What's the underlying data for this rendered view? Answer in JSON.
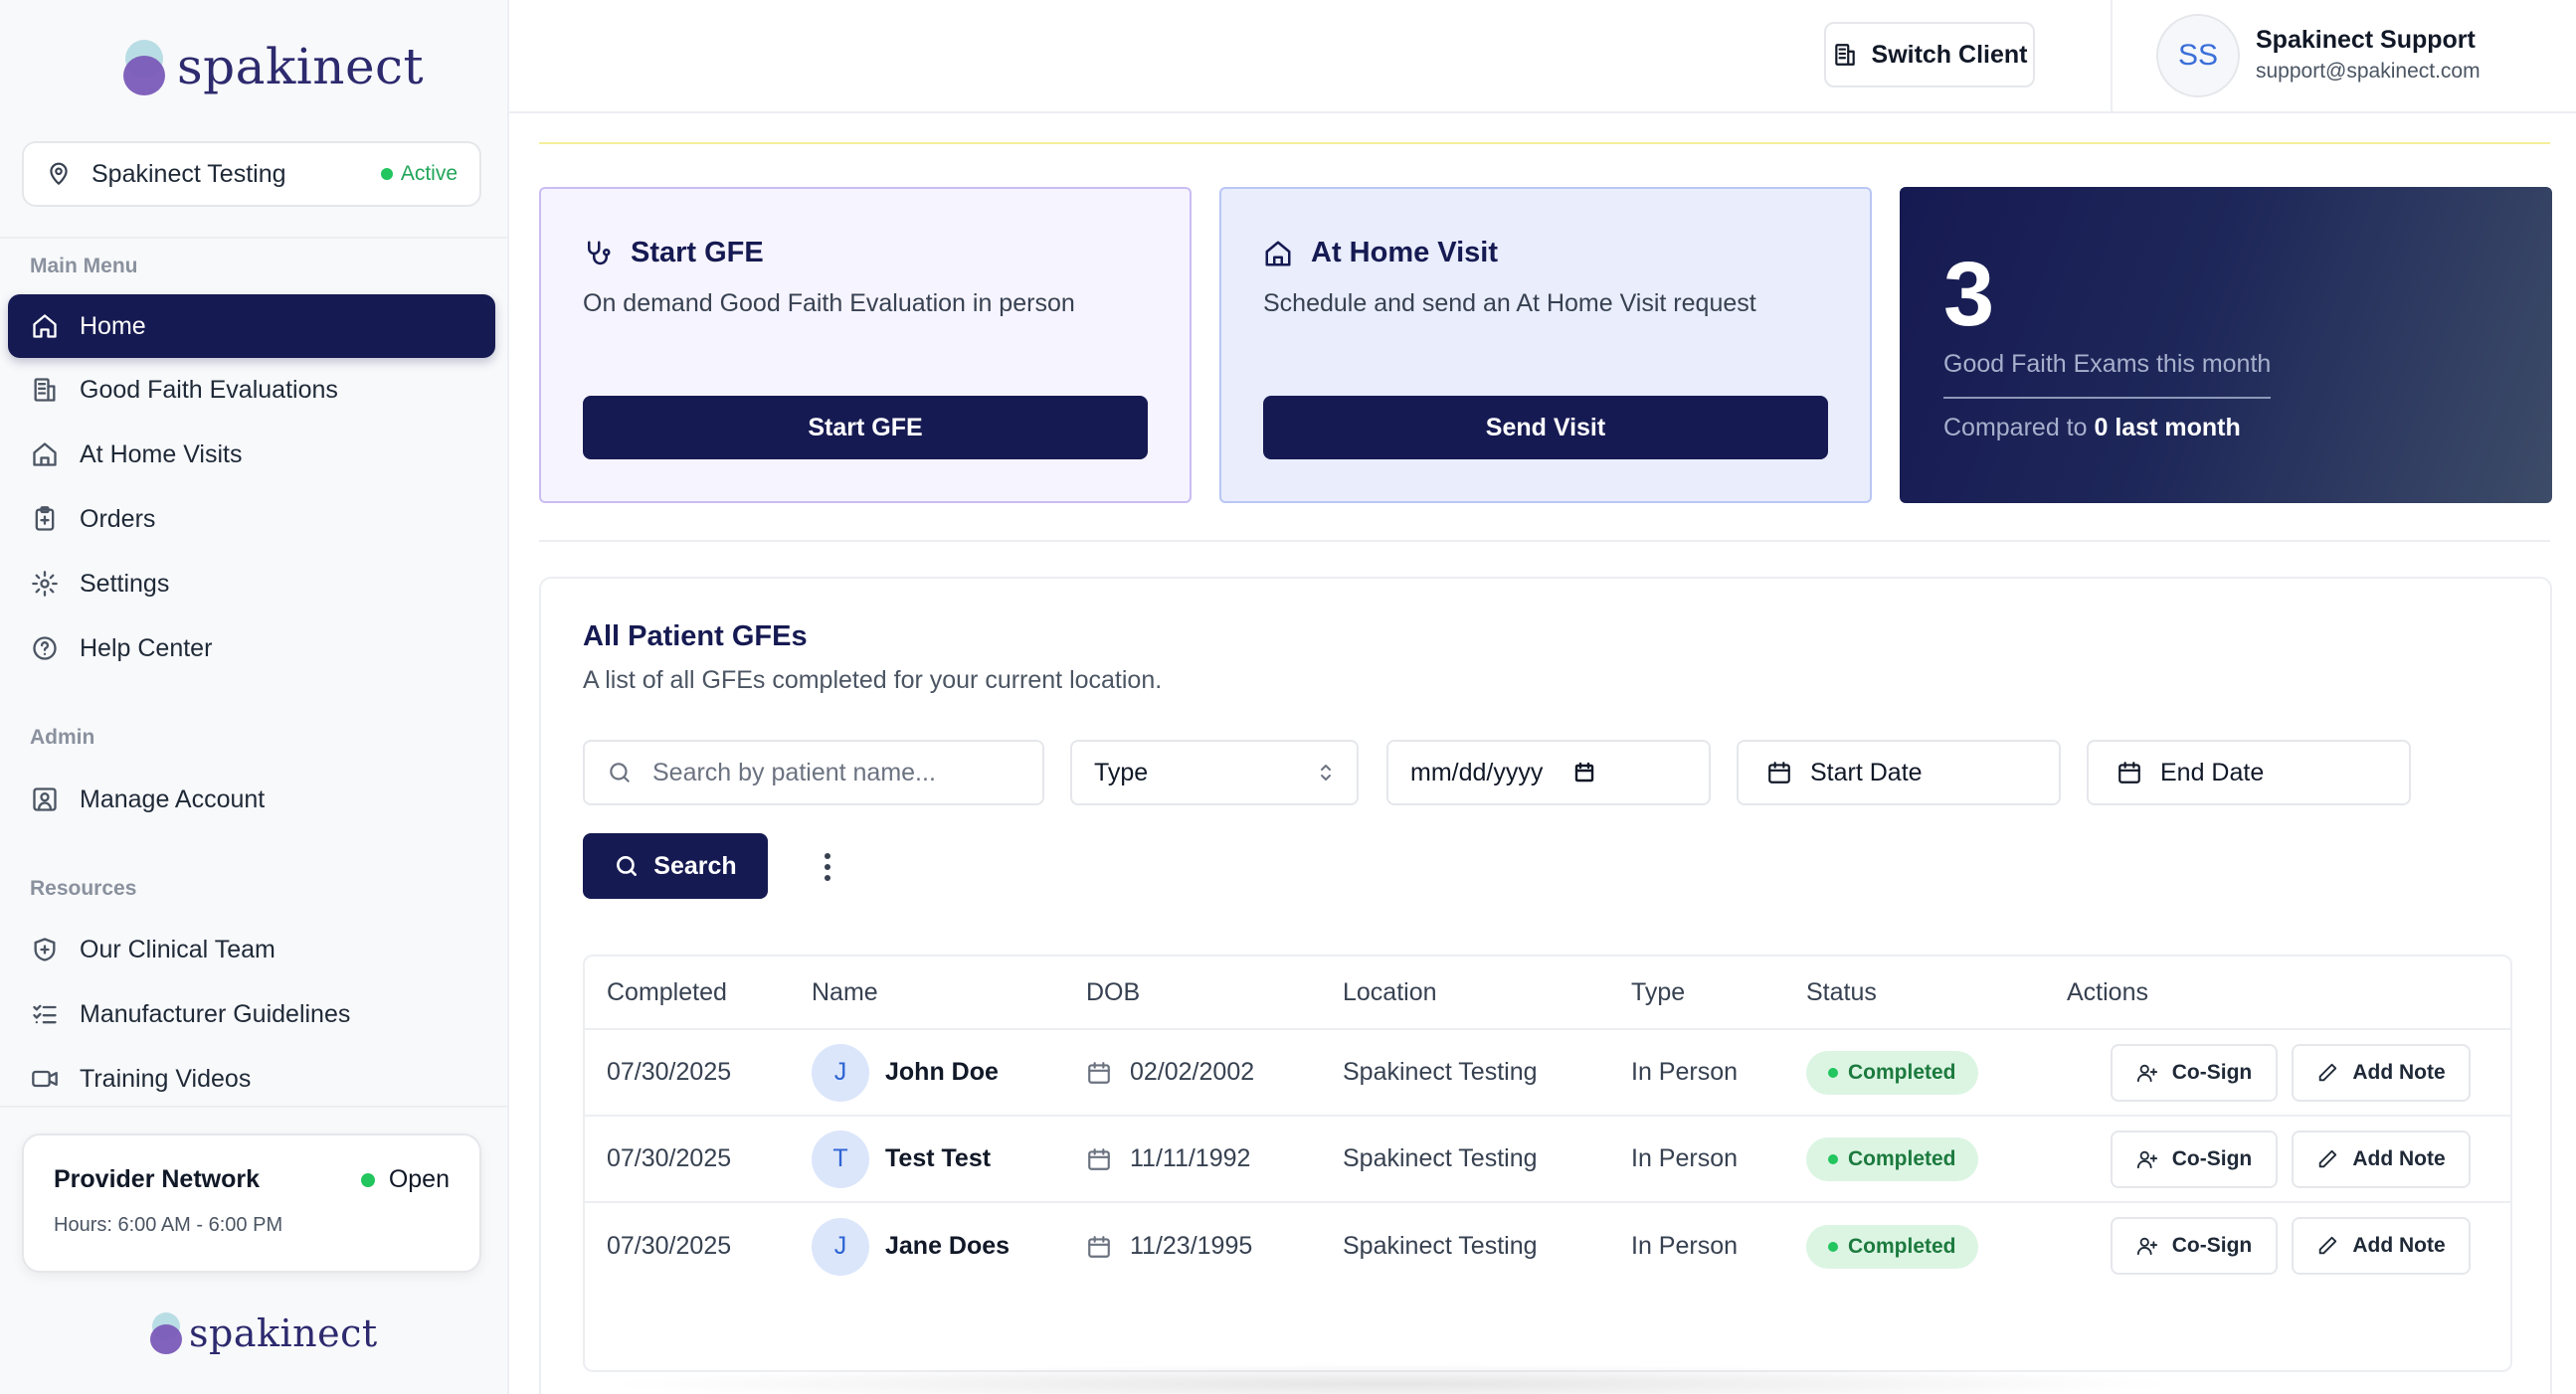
{
  "brand": {
    "name": "spakinect"
  },
  "location": {
    "name": "Spakinect Testing",
    "status": "Active"
  },
  "sidebar": {
    "main_menu_label": "Main Menu",
    "main_menu": [
      {
        "label": "Home",
        "icon": "home-icon",
        "active": true
      },
      {
        "label": "Good Faith Evaluations",
        "icon": "clipboard-building-icon"
      },
      {
        "label": "At Home Visits",
        "icon": "house-icon"
      },
      {
        "label": "Orders",
        "icon": "clipboard-plus-icon"
      },
      {
        "label": "Settings",
        "icon": "gear-icon"
      },
      {
        "label": "Help Center",
        "icon": "help-circle-icon"
      }
    ],
    "admin_label": "Admin",
    "admin": [
      {
        "label": "Manage Account",
        "icon": "user-square-icon"
      }
    ],
    "resources_label": "Resources",
    "resources": [
      {
        "label": "Our Clinical Team",
        "icon": "shield-plus-icon"
      },
      {
        "label": "Manufacturer Guidelines",
        "icon": "list-check-icon"
      },
      {
        "label": "Training Videos",
        "icon": "video-icon"
      }
    ]
  },
  "provider_network": {
    "title": "Provider Network",
    "status": "Open",
    "hours": "Hours: 6:00 AM - 6:00 PM"
  },
  "header": {
    "switch_client": "Switch Client",
    "avatar_initials": "SS",
    "user_name": "Spakinect Support",
    "user_email": "support@spakinect.com"
  },
  "cards": {
    "gfe": {
      "title": "Start GFE",
      "description": "On demand Good Faith Evaluation in person",
      "button": "Start GFE"
    },
    "visit": {
      "title": "At Home Visit",
      "description": "Schedule and send an At Home Visit request",
      "button": "Send Visit"
    },
    "stats": {
      "number": "3",
      "label": "Good Faith Exams this month",
      "compare_prefix": "Compared to",
      "compare_value": "0 last month"
    }
  },
  "table_section": {
    "title": "All Patient GFEs",
    "subtitle": "A list of all GFEs completed for your current location.",
    "search_placeholder": "Search by patient name...",
    "type_select": "Type",
    "date_input": "mm/dd/yyyy",
    "start_date": "Start Date",
    "end_date": "End Date",
    "search_button": "Search",
    "columns": [
      "Completed",
      "Name",
      "DOB",
      "Location",
      "Type",
      "Status",
      "Actions"
    ],
    "rows": [
      {
        "completed": "07/30/2025",
        "initial": "J",
        "name": "John Doe",
        "dob": "02/02/2002",
        "location": "Spakinect Testing",
        "type": "In Person",
        "status": "Completed"
      },
      {
        "completed": "07/30/2025",
        "initial": "T",
        "name": "Test Test",
        "dob": "11/11/1992",
        "location": "Spakinect Testing",
        "type": "In Person",
        "status": "Completed"
      },
      {
        "completed": "07/30/2025",
        "initial": "J",
        "name": "Jane Does",
        "dob": "11/23/1995",
        "location": "Spakinect Testing",
        "type": "In Person",
        "status": "Completed"
      }
    ],
    "cosign_label": "Co-Sign",
    "add_note_label": "Add Note"
  }
}
